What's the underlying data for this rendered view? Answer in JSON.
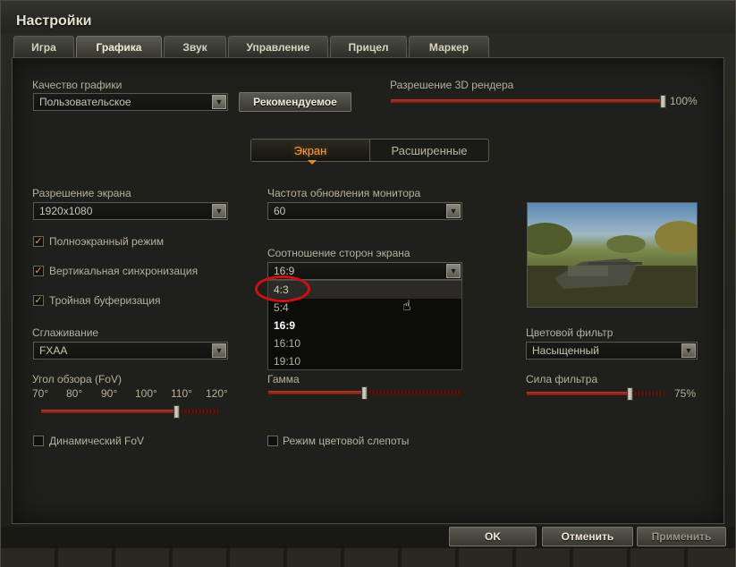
{
  "window": {
    "title": "Настройки"
  },
  "tabs": [
    {
      "label": "Игра",
      "active": false
    },
    {
      "label": "Графика",
      "active": true
    },
    {
      "label": "Звук",
      "active": false
    },
    {
      "label": "Управление",
      "active": false
    },
    {
      "label": "Прицел",
      "active": false
    },
    {
      "label": "Маркер",
      "active": false
    }
  ],
  "graphics": {
    "quality_label": "Качество графики",
    "quality_value": "Пользовательское",
    "recommended_button": "Рекомендуемое",
    "render_res_label": "Разрешение 3D рендера",
    "render_res_value": "100%",
    "render_res_fraction": 1.0
  },
  "subtabs": [
    {
      "label": "Экран",
      "active": true
    },
    {
      "label": "Расширенные",
      "active": false
    }
  ],
  "screen": {
    "resolution_label": "Разрешение экрана",
    "resolution_value": "1920x1080",
    "fullscreen_label": "Полноэкранный режим",
    "vsync_label": "Вертикальная синхронизация",
    "triple_buffer_label": "Тройная буферизация",
    "antialias_label": "Сглаживание",
    "antialias_value": "FXAA",
    "fov_label": "Угол обзора (FoV)",
    "fov_ticks": [
      "70°",
      "80°",
      "90°",
      "100°",
      "110°",
      "120°"
    ],
    "fov_fraction": 0.77,
    "dynamic_fov_label": "Динамический FoV",
    "refresh_label": "Частота обновления монитора",
    "refresh_value": "60",
    "aspect_label": "Соотношение сторон экрана",
    "aspect_value": "16:9",
    "aspect_options": [
      "4:3",
      "5:4",
      "16:9",
      "16:10",
      "19:10"
    ],
    "gamma_label": "Гамма",
    "gamma_fraction": 0.5,
    "colorblind_label": "Режим цветовой слепоты",
    "color_filter_label": "Цветовой фильтр",
    "color_filter_value": "Насыщенный",
    "filter_strength_label": "Сила фильтра",
    "filter_strength_value": "75%",
    "filter_strength_fraction": 0.75
  },
  "footer": {
    "ok": "OK",
    "cancel": "Отменить",
    "apply": "Применить"
  },
  "colors": {
    "accent": "#f2a23a",
    "highlight_ring": "#d01010",
    "slider_fill": "#b13a2a"
  }
}
